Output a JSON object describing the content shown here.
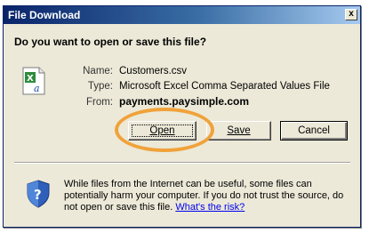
{
  "window": {
    "title": "File Download",
    "close_label": "x"
  },
  "header": {
    "question": "Do you want to open or save this file?"
  },
  "file": {
    "icon": "excel-csv-file-icon",
    "name_label": "Name:",
    "name": "Customers.csv",
    "type_label": "Type:",
    "type": "Microsoft Excel Comma Separated Values File",
    "from_label": "From:",
    "from": "payments.paysimple.com"
  },
  "buttons": {
    "open": "Open",
    "save": "Save",
    "cancel": "Cancel"
  },
  "warning": {
    "icon": "shield-question-icon",
    "text": "While files from the Internet can be useful, some files can potentially harm your computer. If you do not trust the source, do not open or save this file.",
    "link": "What's the risk?"
  },
  "colors": {
    "titlebar": "#0a246a",
    "dialog_bg": "#ece9d8",
    "highlight": "#f0a23a",
    "link": "#0000ee"
  }
}
